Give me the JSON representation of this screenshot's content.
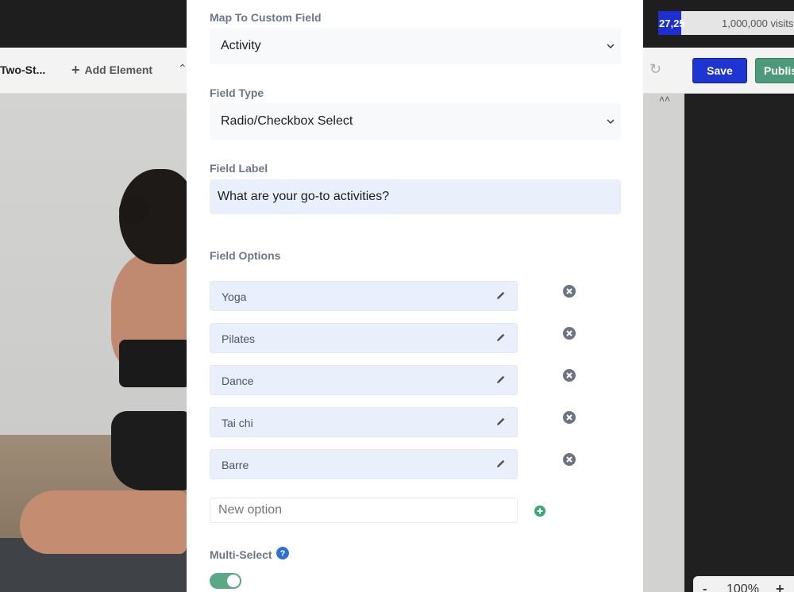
{
  "topbar": {
    "visits_count": "27,25",
    "visits_limit": "1,000,000 visits",
    "visits_used_fraction": 0.027
  },
  "toolbar": {
    "page_title": "Two-St...",
    "add_element": "Add Element",
    "save_label": "Save",
    "publish_label": "Publish"
  },
  "zoom": {
    "minus": "-",
    "value": "100%",
    "plus": "+"
  },
  "form": {
    "map_label": "Map To Custom Field",
    "map_value": "Activity",
    "type_label": "Field Type",
    "type_value": "Radio/Checkbox Select",
    "field_label_label": "Field Label",
    "field_label_value": "What are your go-to activities?",
    "options_label": "Field Options",
    "options": [
      {
        "label": "Yoga"
      },
      {
        "label": "Pilates"
      },
      {
        "label": "Dance"
      },
      {
        "label": "Tai chi"
      },
      {
        "label": "Barre"
      }
    ],
    "new_option_placeholder": "New option",
    "multi_select_label": "Multi-Select",
    "multi_select_on": true
  },
  "colors": {
    "accent_blue": "#1f35d2",
    "accent_green": "#4d9a7a",
    "toggle_green": "#5aa886",
    "label_gray": "#6b7788"
  }
}
